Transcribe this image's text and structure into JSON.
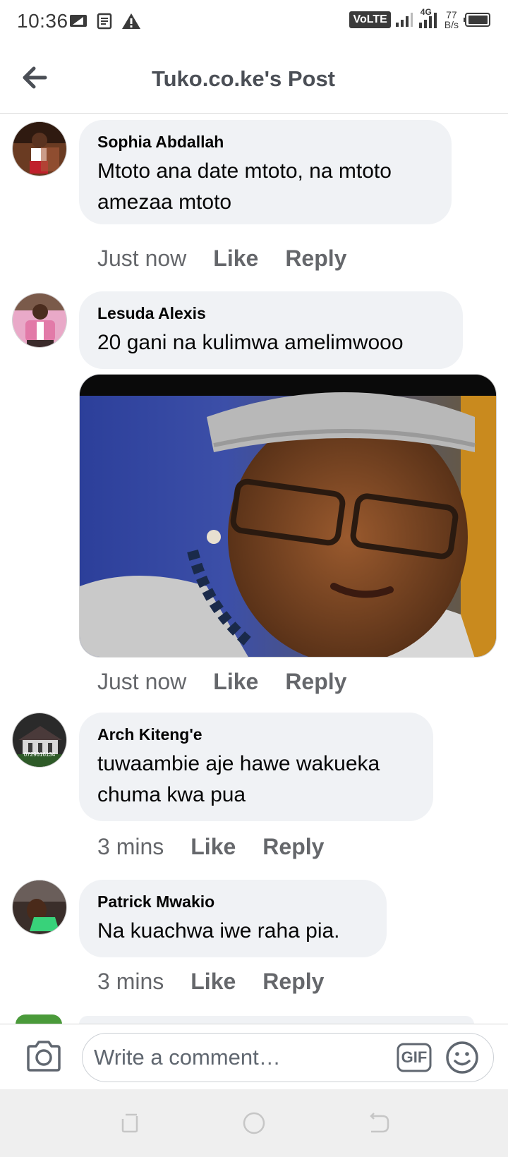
{
  "status_bar": {
    "time": "10:36",
    "network_label": "VoLTE",
    "network_type": "4G",
    "speed_value": "77",
    "speed_unit": "B/s"
  },
  "header": {
    "title": "Tuko.co.ke's Post"
  },
  "comments": [
    {
      "name": "Sophia Abdallah",
      "text": "Mtoto ana date mtoto, na mtoto amezaa mtoto",
      "time": "Just now",
      "like": "Like",
      "reply": "Reply"
    },
    {
      "name": "Lesuda Alexis",
      "text": "20 gani na kulimwa amelimwooo",
      "time": "Just now",
      "like": "Like",
      "reply": "Reply",
      "has_photo": true
    },
    {
      "name": "Arch Kiteng'e",
      "text": "tuwaambie aje hawe wakueka chuma kwa pua",
      "time": "3 mins",
      "like": "Like",
      "reply": "Reply",
      "avatar_text": "0729616134"
    },
    {
      "name": "Patrick Mwakio",
      "text": "Na kuachwa iwe raha pia.",
      "time": "3 mins",
      "like": "Like",
      "reply": "Reply"
    }
  ],
  "composer": {
    "placeholder": "Write a comment…",
    "gif_label": "GIF"
  },
  "colors": {
    "bubble": "#f0f2f5",
    "meta_text": "#65676b",
    "title_text": "#4b4f56"
  },
  "icons": [
    "back-arrow-icon",
    "camera-icon",
    "gif-icon",
    "emoji-icon",
    "recent-apps-icon",
    "home-icon",
    "back-nav-icon"
  ]
}
